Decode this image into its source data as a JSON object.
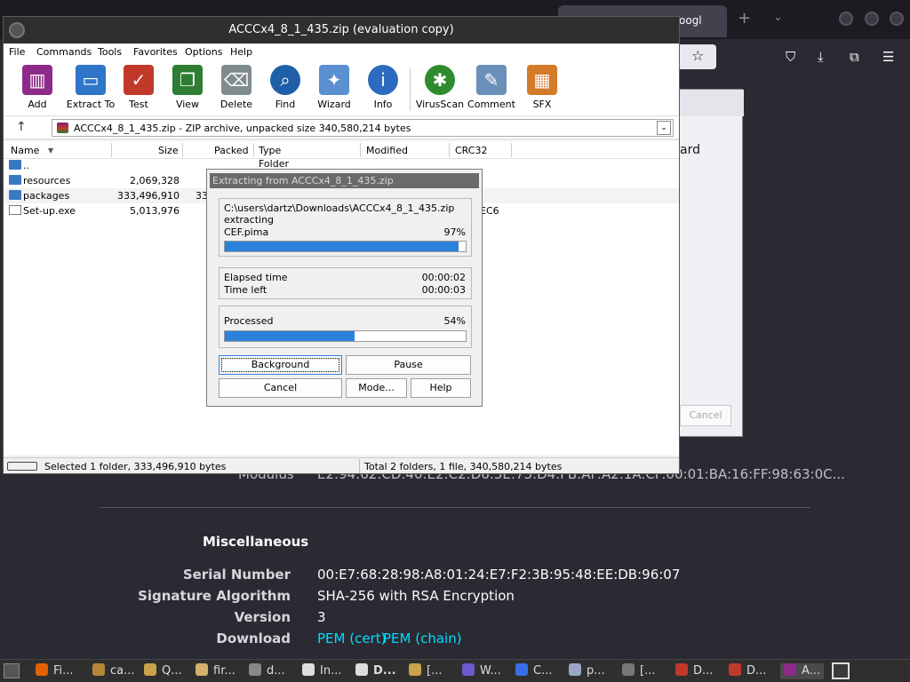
{
  "browser": {
    "tab_title": "oogl",
    "new_tab_symbol": "+",
    "tab_list_symbol": "⌄"
  },
  "bg_dialog": {
    "partial_word": "ard",
    "cancel_label": "Cancel"
  },
  "certificate": {
    "modulus_label": "Modulus",
    "modulus_value": "E2:94:62:CD:40:E2:C2:D6:3E:73:D4:FB:AF:A2:1A:CF:00:01:BA:16:FF:98:63:0C...",
    "section_title": "Miscellaneous",
    "rows": [
      {
        "label": "Serial Number",
        "value": "00:E7:68:28:98:A8:01:24:E7:F2:3B:95:48:EE:DB:96:07"
      },
      {
        "label": "Signature Algorithm",
        "value": "SHA-256 with RSA Encryption"
      },
      {
        "label": "Version",
        "value": "3"
      }
    ],
    "download_label": "Download",
    "download_links": [
      "PEM (cert)",
      "PEM (chain)"
    ]
  },
  "winrar": {
    "title": "ACCCx4_8_1_435.zip (evaluation copy)",
    "menu": [
      "File",
      "Commands",
      "Tools",
      "Favorites",
      "Options",
      "Help"
    ],
    "toolbar": [
      {
        "label": "Add",
        "icon": "books-icon",
        "color": "#8e2a8a"
      },
      {
        "label": "Extract To",
        "icon": "folder-icon",
        "color": "#2f76c8"
      },
      {
        "label": "Test",
        "icon": "clipboard-check-icon",
        "color": "#c0392b"
      },
      {
        "label": "View",
        "icon": "open-book-icon",
        "color": "#2e7d32"
      },
      {
        "label": "Delete",
        "icon": "trash-icon",
        "color": "#7f8c8d"
      },
      {
        "label": "Find",
        "icon": "magnifier-icon",
        "color": "#1f5fa8"
      },
      {
        "label": "Wizard",
        "icon": "magic-wand-icon",
        "color": "#5a8fd0"
      },
      {
        "label": "Info",
        "icon": "info-icon",
        "color": "#2c6bc0"
      },
      {
        "label": "VirusScan",
        "icon": "bug-icon",
        "color": "#2e8b2e"
      },
      {
        "label": "Comment",
        "icon": "speech-bubble-icon",
        "color": "#6a8fb8"
      },
      {
        "label": "SFX",
        "icon": "gift-box-icon",
        "color": "#d47b2a"
      }
    ],
    "address": "ACCCx4_8_1_435.zip - ZIP archive, unpacked size 340,580,214 bytes",
    "columns": [
      "Name",
      "Size",
      "Packed",
      "Type",
      "Modified",
      "CRC32"
    ],
    "files": [
      {
        "name": "..",
        "size": "",
        "packed": "",
        "extra": "Folder",
        "kind": "folder"
      },
      {
        "name": "resources",
        "size": "2,069,328",
        "packed": "",
        "extra": "",
        "kind": "folder"
      },
      {
        "name": "packages",
        "size": "333,496,910",
        "packed": "33",
        "extra": "",
        "kind": "folder"
      },
      {
        "name": "Set-up.exe",
        "size": "5,013,976",
        "packed": "",
        "extra": "EC6",
        "kind": "file"
      }
    ],
    "status_left": "Selected 1 folder, 333,496,910 bytes",
    "status_right": "Total 2 folders, 1 file, 340,580,214 bytes"
  },
  "extract": {
    "title": "Extracting from ACCCx4_8_1_435.zip",
    "path": "C:\\users\\dartz\\Downloads\\ACCCx4_8_1_435.zip",
    "action": "extracting",
    "file": "CEF.pima",
    "file_pct": "97%",
    "file_progress": 0.97,
    "elapsed_label": "Elapsed time",
    "elapsed": "00:00:02",
    "left_label": "Time left",
    "left": "00:00:03",
    "processed_label": "Processed",
    "processed_pct": "54%",
    "processed_progress": 0.54,
    "buttons": {
      "background": "Background",
      "pause": "Pause",
      "cancel": "Cancel",
      "mode": "Mode...",
      "help": "Help"
    }
  },
  "taskbar": [
    {
      "label": "Fi...",
      "color": "#e66000"
    },
    {
      "label": "ca...",
      "color": "#b8863b"
    },
    {
      "label": "Q...",
      "color": "#c9a24a"
    },
    {
      "label": "fir...",
      "color": "#d4b06a"
    },
    {
      "label": "d...",
      "color": "#888888"
    },
    {
      "label": "In...",
      "color": "#dddddd"
    },
    {
      "label": "D...",
      "color": "#dddddd"
    },
    {
      "label": "[...",
      "color": "#c9a24a"
    },
    {
      "label": "W...",
      "color": "#6a5acd"
    },
    {
      "label": "C...",
      "color": "#3a6ee8"
    },
    {
      "label": "p...",
      "color": "#9aa6c8"
    },
    {
      "label": "[...",
      "color": "#777777"
    },
    {
      "label": "D...",
      "color": "#c0392b"
    },
    {
      "label": "D...",
      "color": "#c0392b"
    },
    {
      "label": "A...",
      "color": "#8e2a8a"
    }
  ]
}
